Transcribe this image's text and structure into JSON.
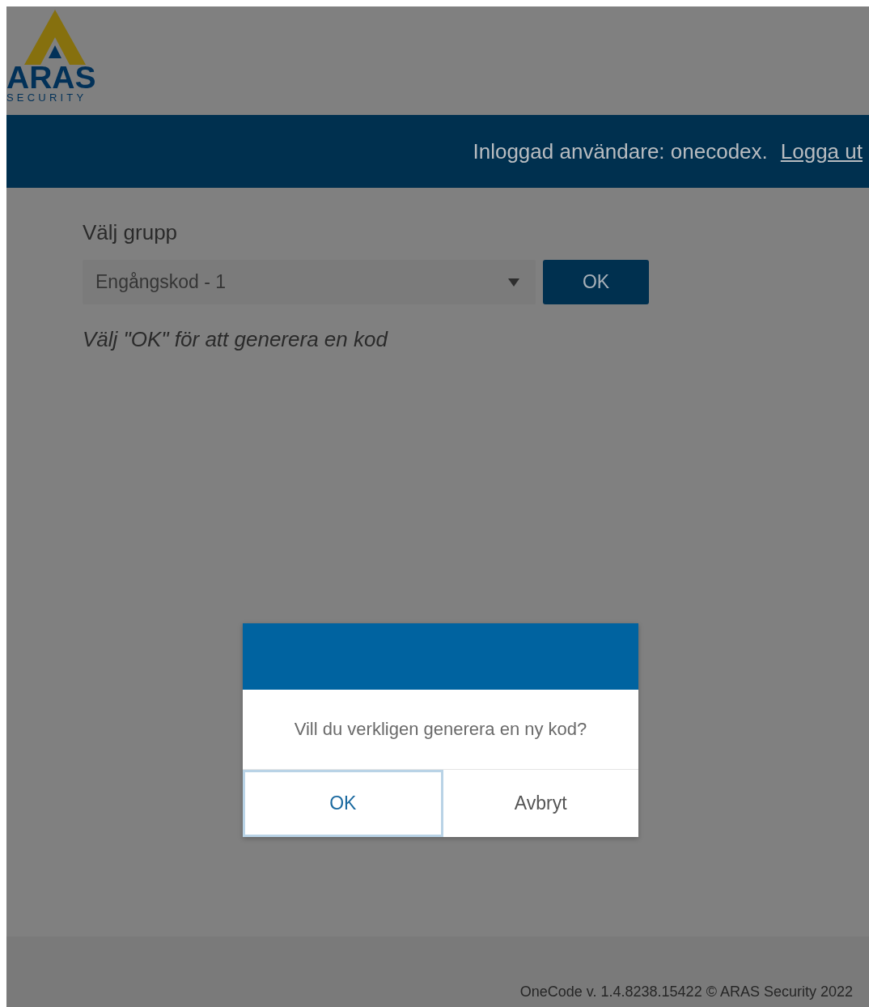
{
  "logo": {
    "name": "ARAS",
    "tagline": "SECURITY"
  },
  "header": {
    "user_text": "Inloggad användare: onecodex.",
    "logout_link": "Logga ut"
  },
  "group_picker": {
    "label": "Välj grupp",
    "value": "Engångskod - 1",
    "button": "OK",
    "hint": "Välj \"OK\" för att generera en kod"
  },
  "dialog": {
    "message": "Vill du verkligen generera en ny kod?",
    "buttons": [
      {
        "label": "OK",
        "selected": true
      },
      {
        "label": "Avbryt",
        "selected": false
      }
    ]
  },
  "footer": {
    "text": "OneCode v. 1.4.8238.15422 © ARAS Security 2022"
  }
}
